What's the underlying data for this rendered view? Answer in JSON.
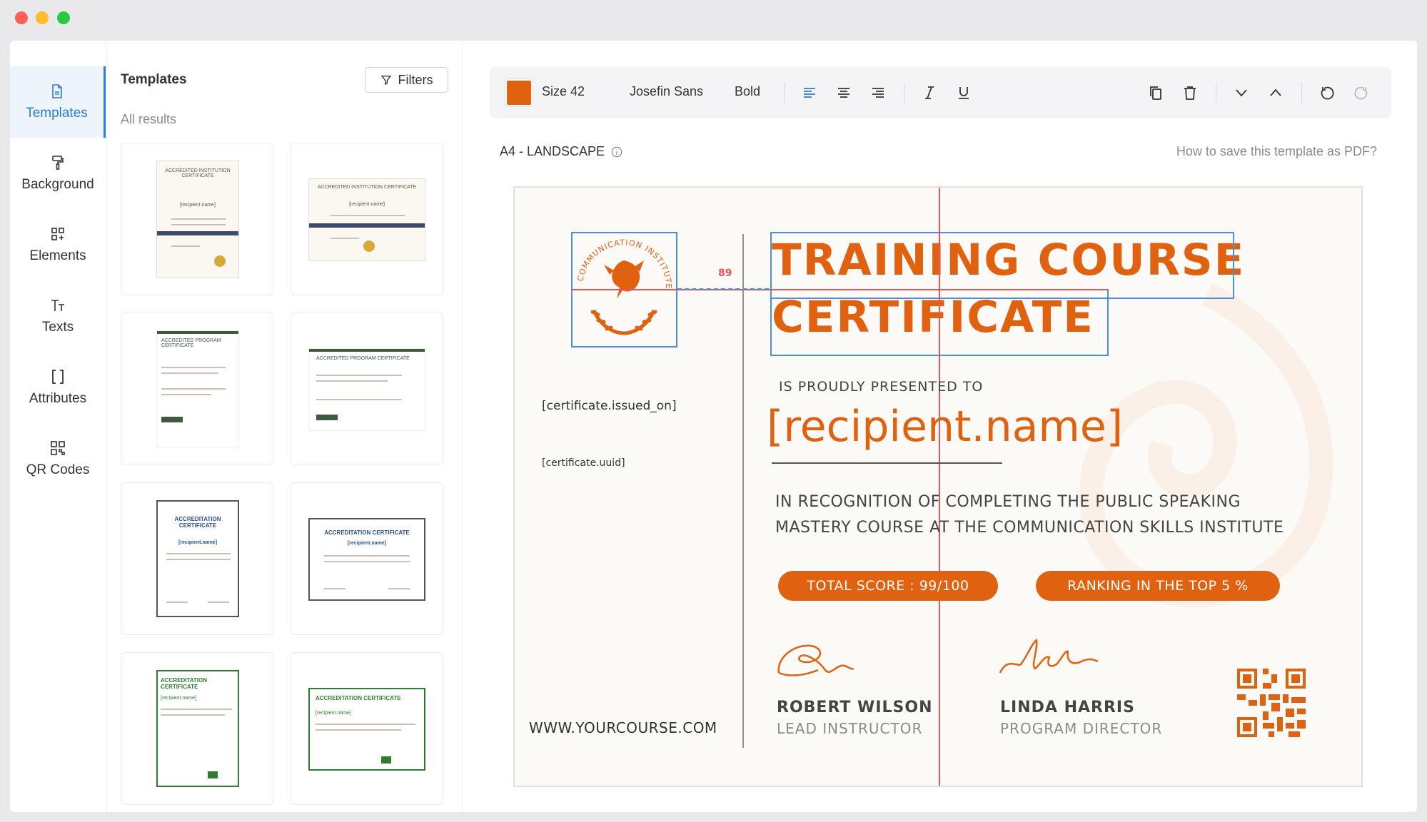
{
  "nav": {
    "items": [
      {
        "label": "Templates",
        "icon": "file-icon",
        "active": true
      },
      {
        "label": "Background",
        "icon": "paint-roller-icon"
      },
      {
        "label": "Elements",
        "icon": "elements-icon"
      },
      {
        "label": "Texts",
        "icon": "text-icon"
      },
      {
        "label": "Attributes",
        "icon": "brackets-icon"
      },
      {
        "label": "QR Codes",
        "icon": "qr-code-icon"
      }
    ]
  },
  "templates_panel": {
    "title": "Templates",
    "filters_label": "Filters",
    "results_label": "All results",
    "thumbnails": [
      {
        "title": "ACCREDITED INSTITUTION CERTIFICATE",
        "recipient": "[recipient.name]",
        "accent": "#3c4a6b"
      },
      {
        "title": "ACCREDITED INSTITUTION CERTIFICATE",
        "recipient": "[recipient.name]",
        "accent": "#3c4a6b"
      },
      {
        "title": "ACCREDITED PROGRAM CERTIFICATE",
        "recipient": "",
        "accent": "#3f5a3f"
      },
      {
        "title": "ACCREDITED PROGRAM CERTIFICATE",
        "recipient": "",
        "accent": "#3f5a3f"
      },
      {
        "title": "ACCREDITATION CERTIFICATE",
        "recipient": "[recipient.name]",
        "accent": "#2c4f8f"
      },
      {
        "title": "ACCREDITATION CERTIFICATE",
        "recipient": "[recipient.name]",
        "accent": "#2c4f8f"
      },
      {
        "title": "ACCREDITATION CERTIFICATE",
        "recipient": "[recipient.name]",
        "accent": "#2e7d32"
      },
      {
        "title": "ACCREDITATION CERTIFICATE",
        "recipient": "[recipient.name]",
        "accent": "#2e7d32"
      }
    ]
  },
  "toolbar": {
    "color": "#e0610f",
    "size_label": "Size 42",
    "font_label": "Josefin Sans",
    "weight_label": "Bold"
  },
  "canvas": {
    "format_label": "A4 - LANDSCAPE",
    "help_link": "How to save this template as PDF?"
  },
  "certificate": {
    "logo_text": "COMMUNICATION INSTITUTE",
    "issued_on": "[certificate.issued_on]",
    "uuid": "[certificate.uuid]",
    "website": "WWW.YOURCOURSE.COM",
    "title_line1": "TRAINING COURSE",
    "title_line2": "CERTIFICATE",
    "guide_distance": "89",
    "presented_to": "IS PROUDLY PRESENTED TO",
    "recipient": "[recipient.name]",
    "recognition_line1": "IN RECOGNITION OF COMPLETING THE PUBLIC SPEAKING",
    "recognition_line2": "MASTERY COURSE AT THE COMMUNICATION SKILLS INSTITUTE",
    "score_pill": "TOTAL SCORE : 99/100",
    "ranking_pill": "RANKING IN THE TOP 5 %",
    "signer1_name": "ROBERT WILSON",
    "signer1_role": "LEAD INSTRUCTOR",
    "signer2_name": "LINDA HARRIS",
    "signer2_role": "PROGRAM DIRECTOR",
    "accent_color": "#e0610f"
  }
}
